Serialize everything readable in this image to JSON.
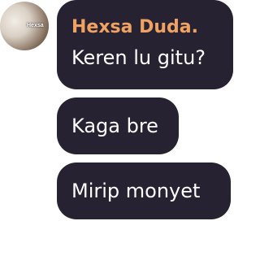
{
  "chat": {
    "avatar": {
      "badge_text": "Hexsa"
    },
    "sender_name": "Hexsa Duda.",
    "messages": [
      "Keren lu gitu?",
      "Kaga bre",
      "Mirip monyet"
    ]
  }
}
